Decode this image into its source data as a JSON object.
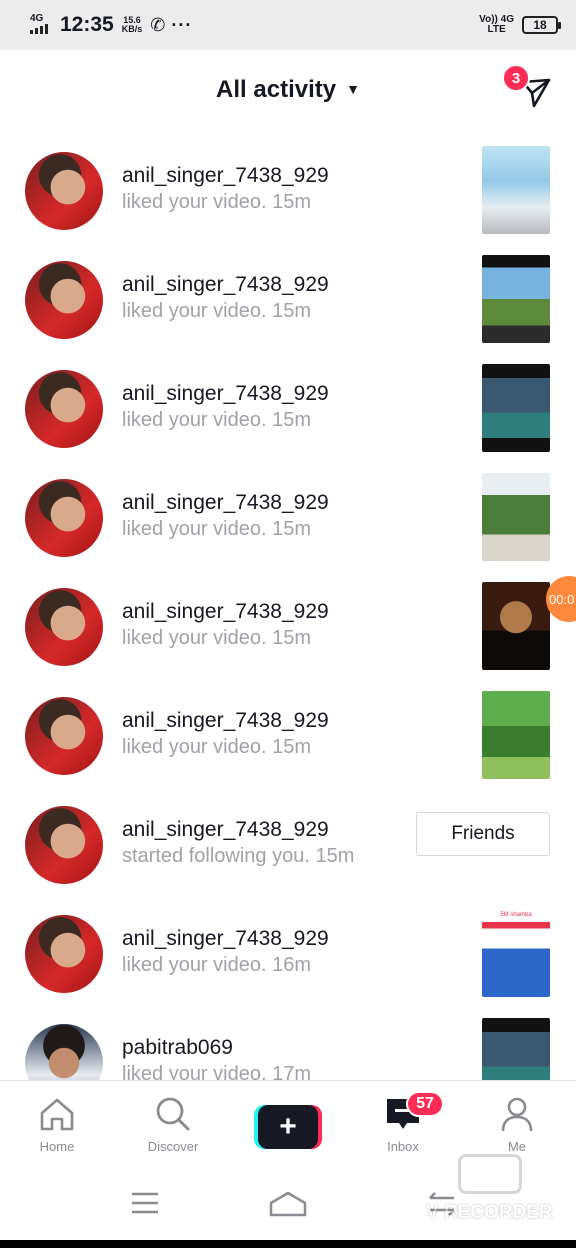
{
  "status_bar": {
    "network_left": "4G",
    "time": "12:35",
    "speed_value": "15.6",
    "speed_unit": "KB/s",
    "more": "···",
    "volte": "Vo))",
    "lte": "LTE",
    "network_right": "4G",
    "battery": "18"
  },
  "header": {
    "title": "All activity",
    "dm_badge": "3"
  },
  "activity": [
    {
      "username": "anil_singer_7438_929",
      "message": "liked your video.",
      "time": "15m",
      "thumb": "t1",
      "caption": ""
    },
    {
      "username": "anil_singer_7438_929",
      "message": "liked your video.",
      "time": "15m",
      "thumb": "t2",
      "caption": ""
    },
    {
      "username": "anil_singer_7438_929",
      "message": "liked your video.",
      "time": "15m",
      "thumb": "t3",
      "caption": ""
    },
    {
      "username": "anil_singer_7438_929",
      "message": "liked your video.",
      "time": "15m",
      "thumb": "t4",
      "caption": ""
    },
    {
      "username": "anil_singer_7438_929",
      "message": "liked your video.",
      "time": "15m",
      "thumb": "t5",
      "caption": ""
    },
    {
      "username": "anil_singer_7438_929",
      "message": "liked your video.",
      "time": "15m",
      "thumb": "t6",
      "caption": ""
    },
    {
      "username": "anil_singer_7438_929",
      "message": "started following you.",
      "time": "15m",
      "button": "Friends"
    },
    {
      "username": "anil_singer_7438_929",
      "message": "liked your video.",
      "time": "16m",
      "thumb": "t7",
      "caption": "5M shamba"
    },
    {
      "username": "pabitrab069",
      "message": "liked your video.",
      "time": "17m",
      "thumb": "t8",
      "caption": ""
    }
  ],
  "recorder_bubble": "00:0",
  "tabs": [
    {
      "label": "Home",
      "icon": "home-icon"
    },
    {
      "label": "Discover",
      "icon": "search-icon"
    },
    {
      "label": "",
      "icon": "plus-icon"
    },
    {
      "label": "Inbox",
      "icon": "inbox-icon",
      "badge": "57"
    },
    {
      "label": "Me",
      "icon": "profile-icon"
    }
  ],
  "watermark": "V RECORDER",
  "colors": {
    "accent": "#fe2c55",
    "cyan": "#25f4ee",
    "text": "#161823",
    "muted": "#a0a2a8"
  }
}
